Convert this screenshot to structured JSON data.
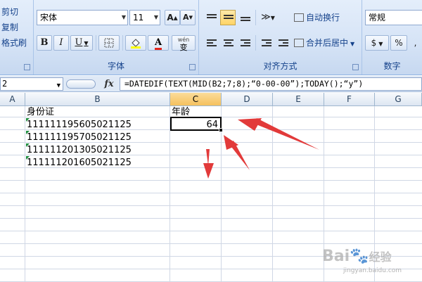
{
  "clipboard": {
    "cut": "剪切",
    "copy": "复制",
    "format_painter": "格式刷"
  },
  "font": {
    "name": "宋体",
    "size": "11",
    "grow_icon": "A▴",
    "shrink_icon": "A▾",
    "bold": "B",
    "italic": "I",
    "underline": "U",
    "wen": "wén",
    "wen_char": "变",
    "group_label": "字体"
  },
  "alignment": {
    "wrap_text": "自动换行",
    "merge_center": "合并后居中",
    "group_label": "对齐方式"
  },
  "number": {
    "format": "常规",
    "currency": "$",
    "percent": "%",
    "group_label": "数字"
  },
  "formula_bar": {
    "name_box": "2",
    "fx": "fx",
    "formula": "=DATEDIF(TEXT(MID(B2;7;8);“0-00-00”);TODAY();“y”)"
  },
  "columns": [
    "A",
    "B",
    "C",
    "D",
    "E",
    "F",
    "G"
  ],
  "cells": {
    "b1": "身份证",
    "c1": "年龄",
    "ids": [
      "111111195605021125",
      "111111195705021125",
      "111111201305021125",
      "111111201605021125"
    ],
    "c2": "64"
  },
  "watermark": {
    "text": "Bai",
    "cn": "经验",
    "url": "jingyan.baidu.com"
  },
  "colors": {
    "arrow": "#e23a3a",
    "selected_header": "#f5c15e",
    "ribbon": "#d5e3f6"
  }
}
